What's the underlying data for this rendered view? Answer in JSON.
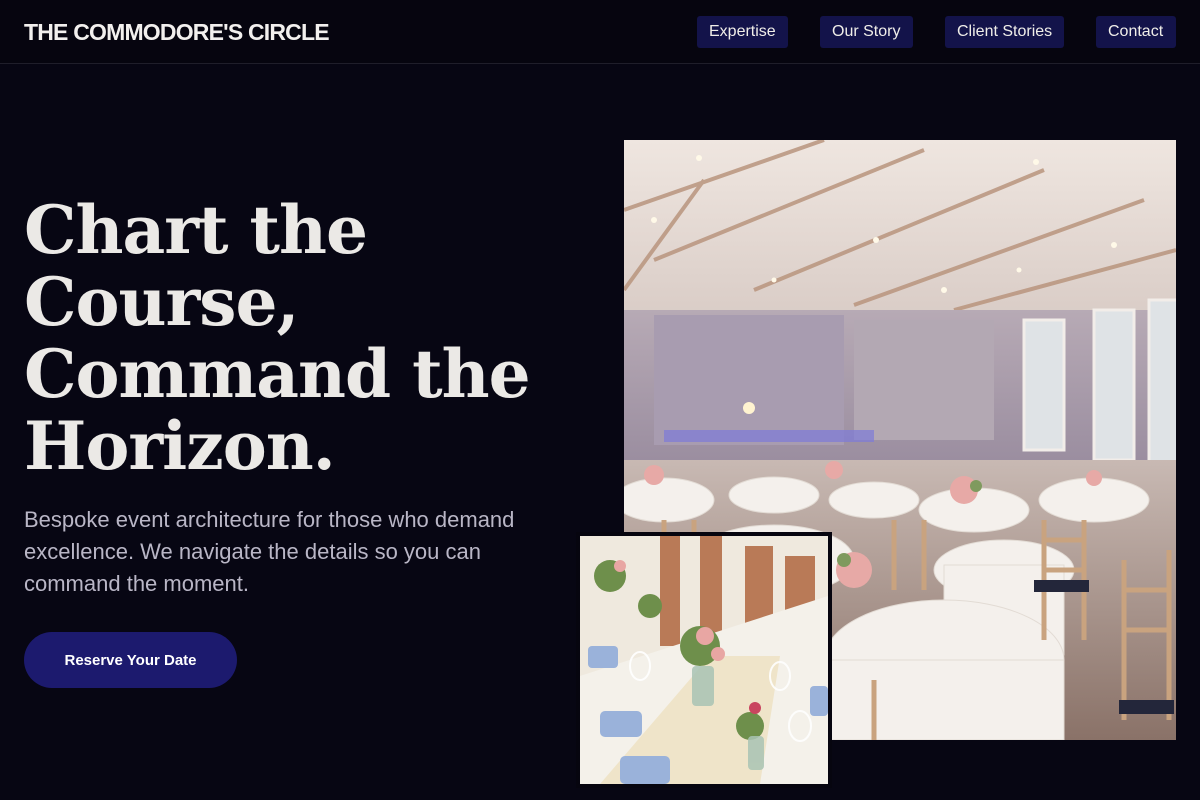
{
  "header": {
    "brand": "THE COMMODORE'S CIRCLE",
    "nav": [
      "Expertise",
      "Our Story",
      "Client Stories",
      "Contact"
    ]
  },
  "hero": {
    "title_lines": [
      "Chart the",
      "Course,",
      "Command the",
      "Horizon."
    ],
    "subtitle": "Bespoke event architecture for those who demand excellence. We navigate the details so you can command the moment.",
    "cta": "Reserve Your Date"
  },
  "images": {
    "main": "banquet-hall-photo",
    "inset": "table-centerpiece-photo"
  },
  "colors": {
    "background": "#070613",
    "nav_button": "#13134a",
    "cta": "#1c1a6e",
    "text": "#ebe9e6",
    "subtext": "#b9b6c6"
  }
}
